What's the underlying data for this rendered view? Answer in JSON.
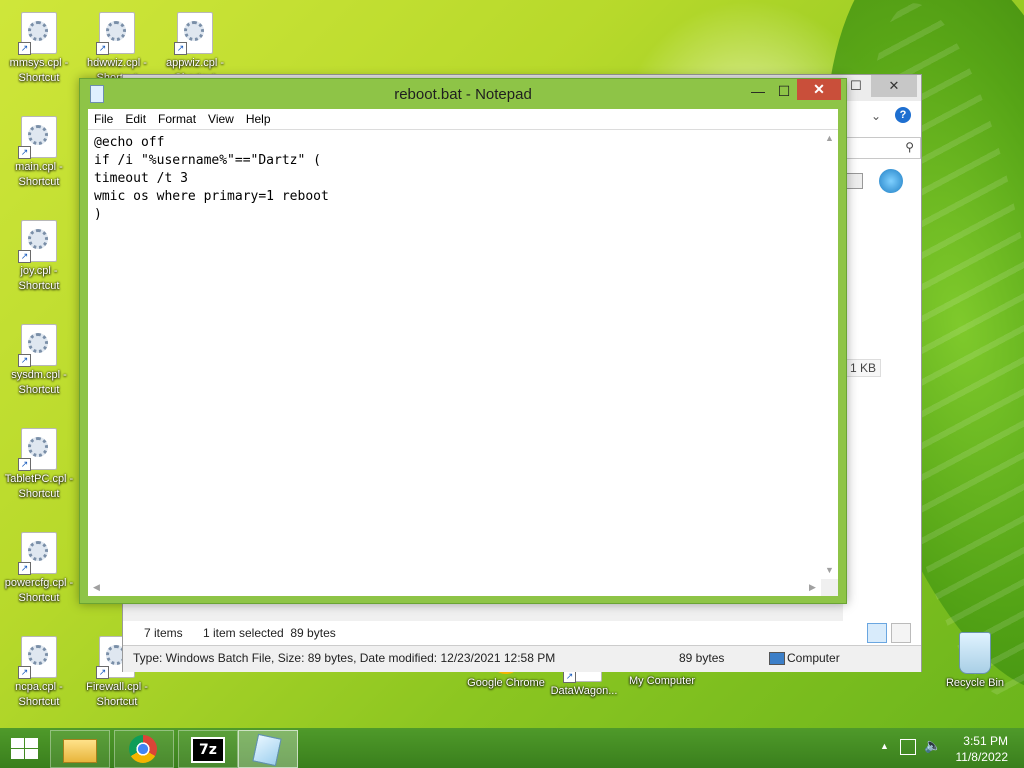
{
  "desktop": {
    "icons": [
      {
        "label": "mmsys.cpl - Shortcut"
      },
      {
        "label": "hdwwiz.cpl - Shortcut"
      },
      {
        "label": "appwiz.cpl - Shortcut"
      },
      {
        "label": "main.cpl - Shortcut"
      },
      {
        "label": "joy.cpl - Shortcut"
      },
      {
        "label": "sysdm.cpl - Shortcut"
      },
      {
        "label": "TabletPC.cpl - Shortcut"
      },
      {
        "label": "powercfg.cpl - Shortcut"
      },
      {
        "label": "ncpa.cpl - Shortcut"
      },
      {
        "label": "Firewall.cpl - Shortcut"
      },
      {
        "label": "Google Chrome"
      },
      {
        "label": "DataWagon..."
      },
      {
        "label": "My Computer"
      },
      {
        "label": "Recycle Bin"
      }
    ]
  },
  "explorer": {
    "size_fragment": "1 KB",
    "status": {
      "items": "7 items",
      "selected": "1 item selected  89 bytes"
    },
    "details": {
      "type_text": "Type: Windows Batch File, Size: 89 bytes, Date modified: 12/23/2021 12:58 PM",
      "size": "89 bytes",
      "location": "Computer"
    }
  },
  "notepad": {
    "title": "reboot.bat - Notepad",
    "menu": [
      "File",
      "Edit",
      "Format",
      "View",
      "Help"
    ],
    "content": "@echo off\nif /i \"%username%\"==\"Dartz\" (\ntimeout /t 3\nwmic os where primary=1 reboot\n)"
  },
  "taskbar": {
    "clock_time": "3:51 PM",
    "clock_date": "11/8/2022",
    "app_7zip_label": "7z"
  },
  "colors": {
    "notepad_frame": "#8ec447",
    "close_button": "#c94f3a",
    "taskbar": "#3a7f1d"
  }
}
